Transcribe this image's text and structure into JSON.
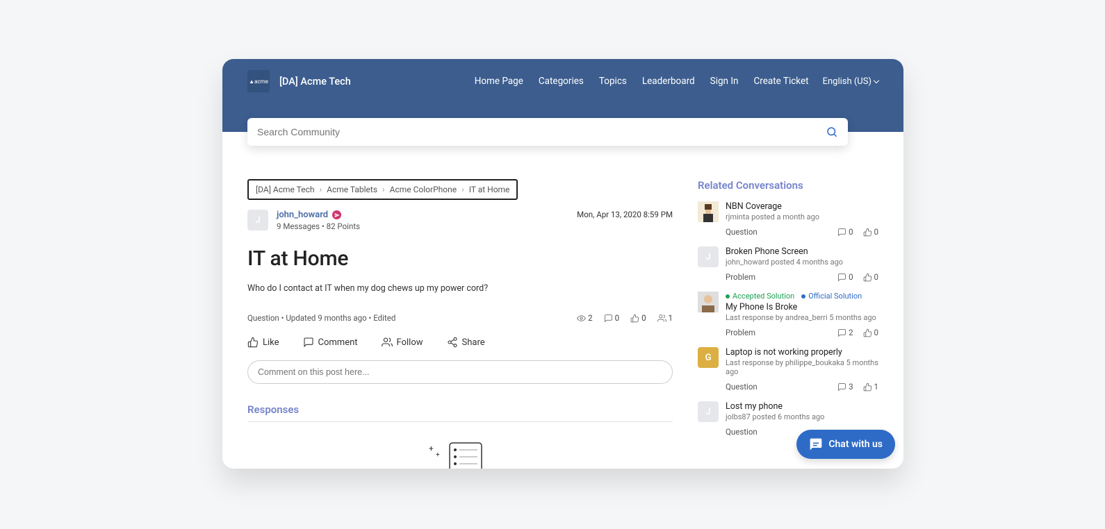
{
  "header": {
    "logo_text": "▲acme",
    "site_name": "[DA] Acme Tech",
    "nav": [
      "Home Page",
      "Categories",
      "Topics",
      "Leaderboard",
      "Sign In",
      "Create Ticket"
    ],
    "language": "English (US)"
  },
  "search": {
    "placeholder": "Search Community"
  },
  "breadcrumb": [
    "[DA] Acme Tech",
    "Acme Tablets",
    "Acme ColorPhone",
    "IT at Home"
  ],
  "post": {
    "avatar_letter": "J",
    "author": "john_howard",
    "stats": "9 Messages • 82 Points",
    "date": "Mon, Apr 13, 2020 8:59 PM",
    "title": "IT at Home",
    "body": "Who do I contact at IT when my dog chews up my power cord?",
    "meta": "Question • Updated 9 months ago • Edited",
    "views": "2",
    "comments": "0",
    "likes": "0",
    "followers": "1"
  },
  "actions": {
    "like": "Like",
    "comment": "Comment",
    "follow": "Follow",
    "share": "Share"
  },
  "comment_placeholder": "Comment on this post here...",
  "responses_heading": "Responses",
  "sidebar": {
    "heading": "Related Conversations",
    "items": [
      {
        "avatar_type": "img",
        "title": "NBN Coverage",
        "sub": "rjminta posted a month ago",
        "type": "Question",
        "comments": "0",
        "likes": "0",
        "tags": []
      },
      {
        "avatar_type": "gray",
        "avatar_letter": "J",
        "title": "Broken Phone Screen",
        "sub": "john_howard posted 4 months ago",
        "type": "Problem",
        "comments": "0",
        "likes": "0",
        "tags": []
      },
      {
        "avatar_type": "img2",
        "title": "My Phone Is Broke",
        "sub": "Last response by andrea_berri 5 months ago",
        "type": "Problem",
        "comments": "2",
        "likes": "0",
        "tags": [
          {
            "cls": "green",
            "text": "Accepted Solution"
          },
          {
            "cls": "blue",
            "text": "Official Solution"
          }
        ]
      },
      {
        "avatar_type": "yellow",
        "avatar_letter": "G",
        "title": "Laptop is not working properly",
        "sub": "Last response by philippe_boukaka 5 months ago",
        "type": "Question",
        "comments": "3",
        "likes": "1",
        "tags": []
      },
      {
        "avatar_type": "gray",
        "avatar_letter": "J",
        "title": "Lost my phone",
        "sub": "jolbs87 posted 6 months ago",
        "type": "Question",
        "comments": "",
        "likes": "",
        "tags": []
      }
    ]
  },
  "chat": "Chat with us"
}
